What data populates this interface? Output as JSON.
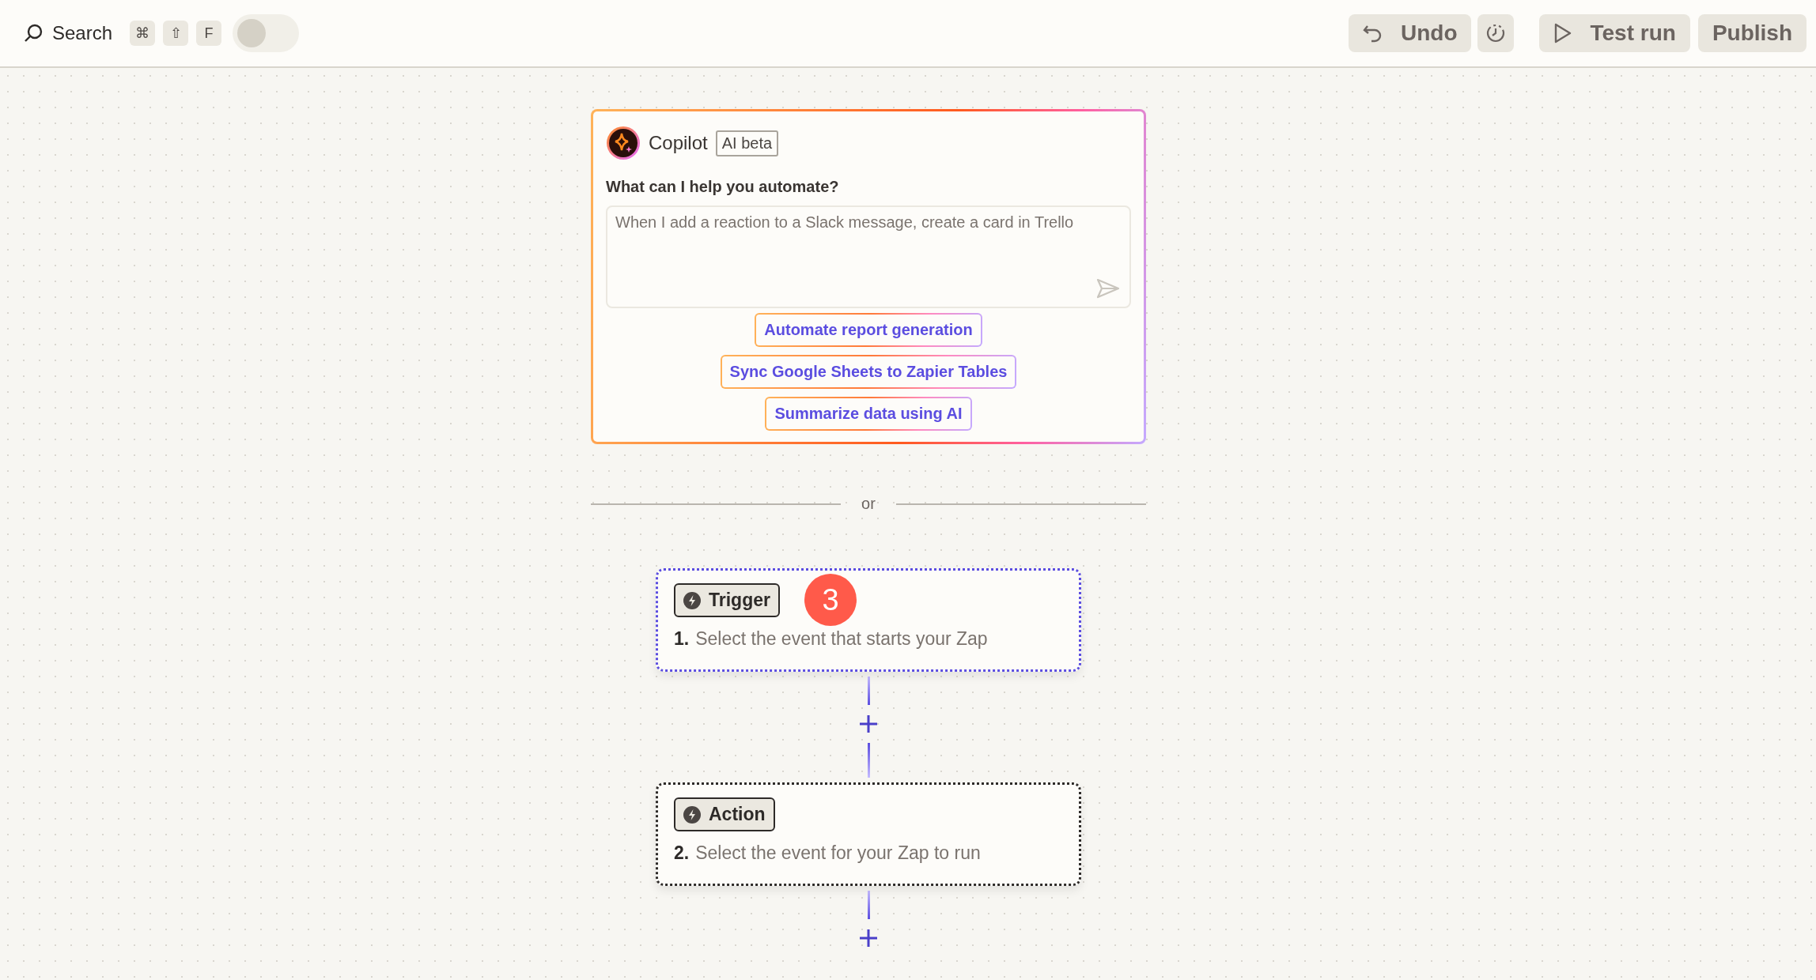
{
  "toolbar": {
    "search": {
      "label": "Search",
      "keys": [
        "⌘",
        "⇧",
        "F"
      ]
    },
    "toggle": {
      "on": false
    },
    "undo": "Undo",
    "test_run": "Test run",
    "publish": "Publish"
  },
  "copilot": {
    "title": "Copilot",
    "tag": "AI beta",
    "question": "What can I help you automate?",
    "placeholder": "When I add a reaction to a Slack message, create a card in Trello",
    "suggestions": [
      "Automate report generation",
      "Sync Google Sheets to Zapier Tables",
      "Summarize data using AI"
    ]
  },
  "divider": "or",
  "steps": [
    {
      "label": "Trigger",
      "number": "1.",
      "text": "Select the event that starts your Zap",
      "selected": true,
      "badge": "3"
    },
    {
      "label": "Action",
      "number": "2.",
      "text": "Select the event for your Zap to run",
      "selected": false
    }
  ]
}
